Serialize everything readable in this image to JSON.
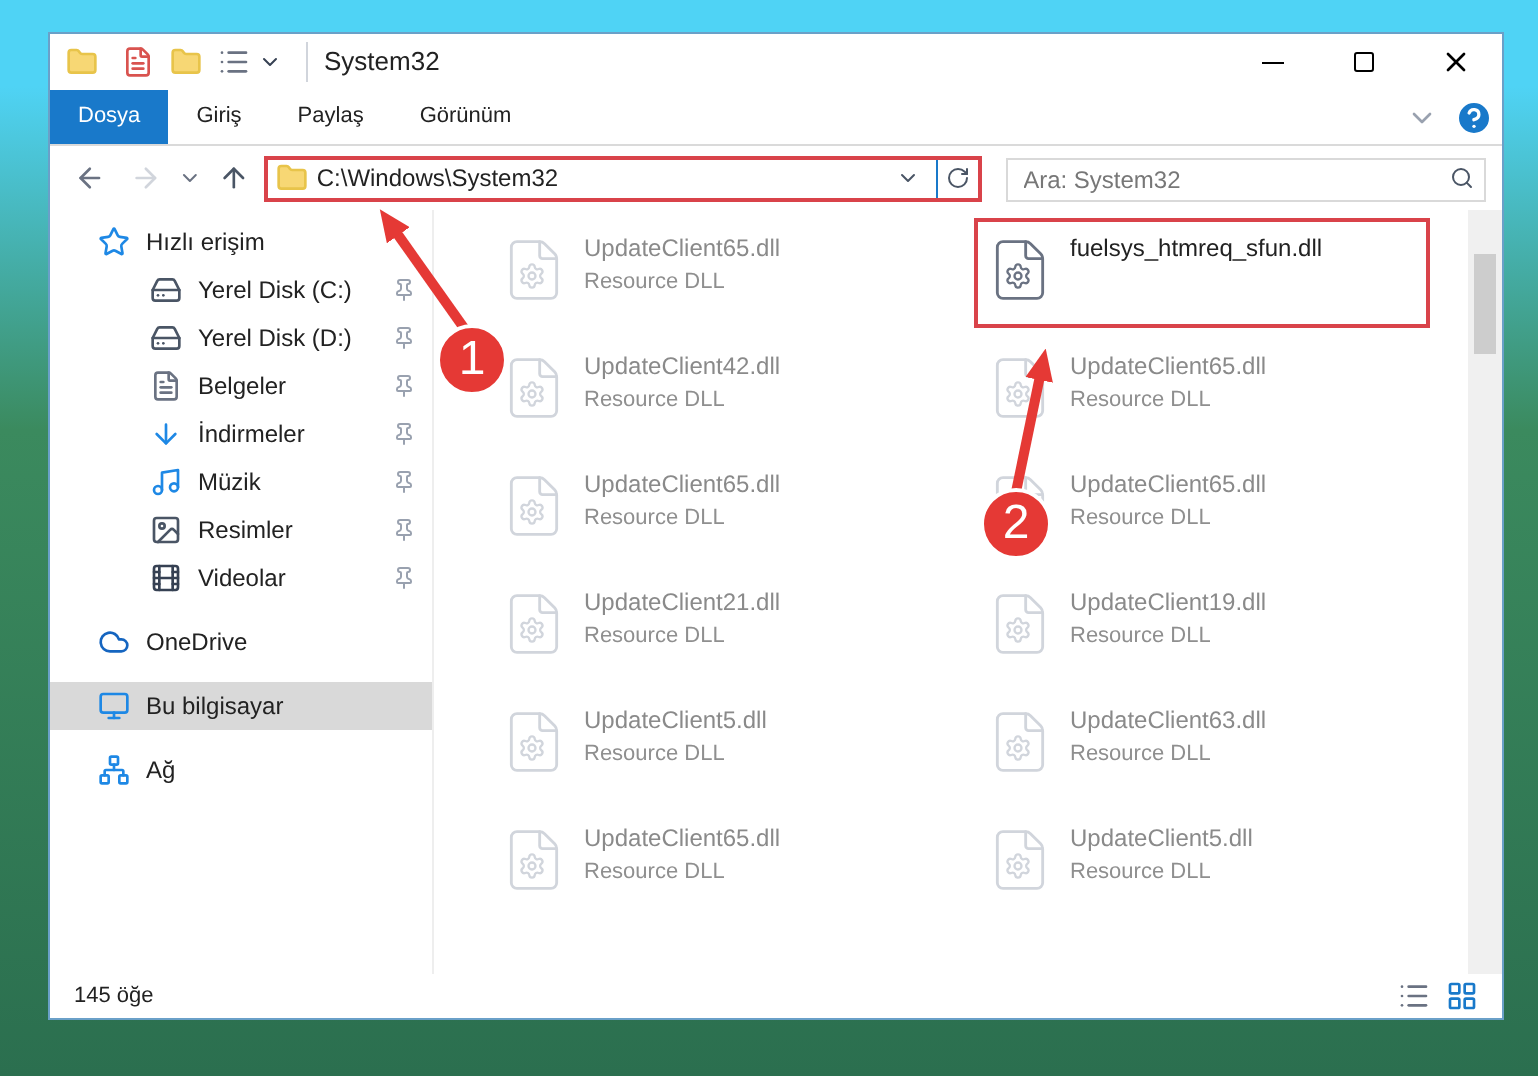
{
  "window": {
    "title": "System32"
  },
  "ribbon_tabs": [
    {
      "label": "Dosya",
      "selected": true
    },
    {
      "label": "Giriş",
      "selected": false
    },
    {
      "label": "Paylaş",
      "selected": false
    },
    {
      "label": "Görünüm",
      "selected": false
    }
  ],
  "address": {
    "path": "C:\\Windows\\System32"
  },
  "search": {
    "placeholder": "Ara: System32"
  },
  "sidebar": {
    "items": [
      {
        "label": "Hızlı erişim",
        "kind": "star",
        "selected": false,
        "children": [
          {
            "label": "Yerel Disk (C:)",
            "kind": "drive",
            "pinned": true,
            "selected": false
          },
          {
            "label": "Yerel Disk (D:)",
            "kind": "drive",
            "pinned": true,
            "selected": false
          },
          {
            "label": "Belgeler",
            "kind": "document",
            "pinned": true,
            "selected": false
          },
          {
            "label": "İndirmeler",
            "kind": "download",
            "pinned": true,
            "selected": false
          },
          {
            "label": "Müzik",
            "kind": "music",
            "pinned": true,
            "selected": false
          },
          {
            "label": "Resimler",
            "kind": "picture",
            "pinned": true,
            "selected": false
          },
          {
            "label": "Videolar",
            "kind": "video",
            "pinned": true,
            "selected": false
          }
        ]
      },
      {
        "label": "OneDrive",
        "kind": "cloud",
        "selected": false
      },
      {
        "label": "Bu bilgisayar",
        "kind": "computer",
        "selected": true
      },
      {
        "label": "Ağ",
        "kind": "network",
        "selected": false
      }
    ]
  },
  "files": [
    {
      "name": "UpdateClient65.dll",
      "type": "Resource DLL",
      "dimmed": true,
      "highlighted": false
    },
    {
      "name": "fuelsys_htmreq_sfun.dll",
      "dimmed": false,
      "highlighted": true
    },
    {
      "name": "UpdateClient42.dll",
      "type": "Resource DLL",
      "dimmed": true,
      "highlighted": false
    },
    {
      "name": "UpdateClient65.dll",
      "type": "Resource DLL",
      "dimmed": true,
      "highlighted": false
    },
    {
      "name": "UpdateClient65.dll",
      "type": "Resource DLL",
      "dimmed": true,
      "highlighted": false
    },
    {
      "name": "UpdateClient65.dll",
      "type": "Resource DLL",
      "dimmed": true,
      "highlighted": false
    },
    {
      "name": "UpdateClient21.dll",
      "type": "Resource DLL",
      "dimmed": true,
      "highlighted": false
    },
    {
      "name": "UpdateClient19.dll",
      "type": "Resource DLL",
      "dimmed": true,
      "highlighted": false
    },
    {
      "name": "UpdateClient5.dll",
      "type": "Resource DLL",
      "dimmed": true,
      "highlighted": false
    },
    {
      "name": "UpdateClient63.dll",
      "type": "Resource DLL",
      "dimmed": true,
      "highlighted": false
    },
    {
      "name": "UpdateClient65.dll",
      "type": "Resource DLL",
      "dimmed": true,
      "highlighted": false
    },
    {
      "name": "UpdateClient5.dll",
      "type": "Resource DLL",
      "dimmed": true,
      "highlighted": false
    }
  ],
  "status_bar": {
    "count": "145 öğe"
  },
  "annotations": [
    {
      "label": "1"
    },
    {
      "label": "2"
    }
  ]
}
